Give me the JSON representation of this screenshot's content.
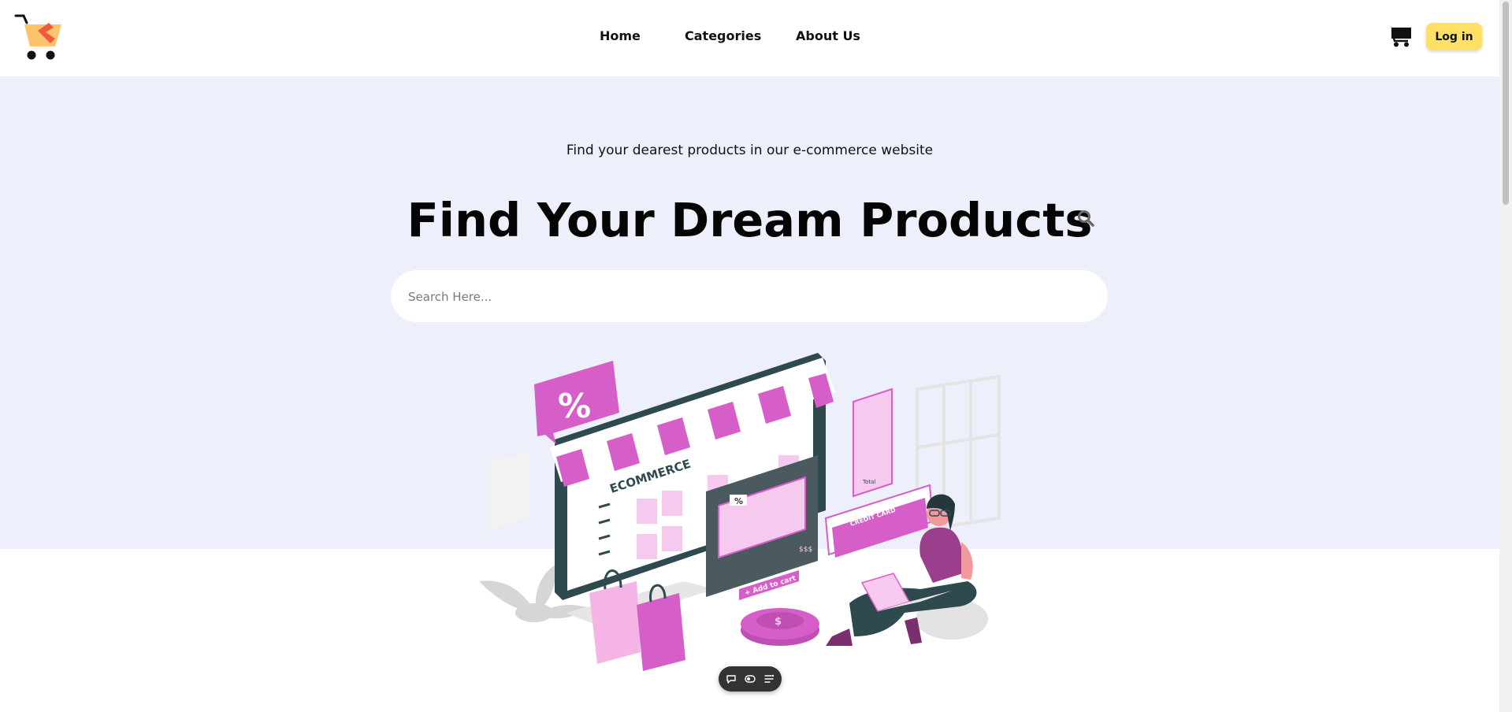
{
  "header": {
    "nav": {
      "home": "Home",
      "categories": "Categories",
      "about": "About Us"
    },
    "login_label": "Log in",
    "icons": {
      "logo": "cart-logo-icon",
      "cart": "shopping-cart-icon"
    }
  },
  "hero": {
    "subtitle": "Find your dearest products in our e-commerce website",
    "title": "Find Your Dream Products",
    "search": {
      "placeholder": "Search Here...",
      "value": ""
    }
  },
  "illustration": {
    "shop_label": "ECOMMERCE",
    "card_label": "CREDIT CARD",
    "add_to_cart": "+ Add to cart",
    "total_label": "Total",
    "price_label": "$$$"
  },
  "colors": {
    "hero_bg": "#edf0fa",
    "accent_pink": "#d65ec8",
    "button_yellow": "#ffe066",
    "dark_teal": "#2f4a4f"
  }
}
